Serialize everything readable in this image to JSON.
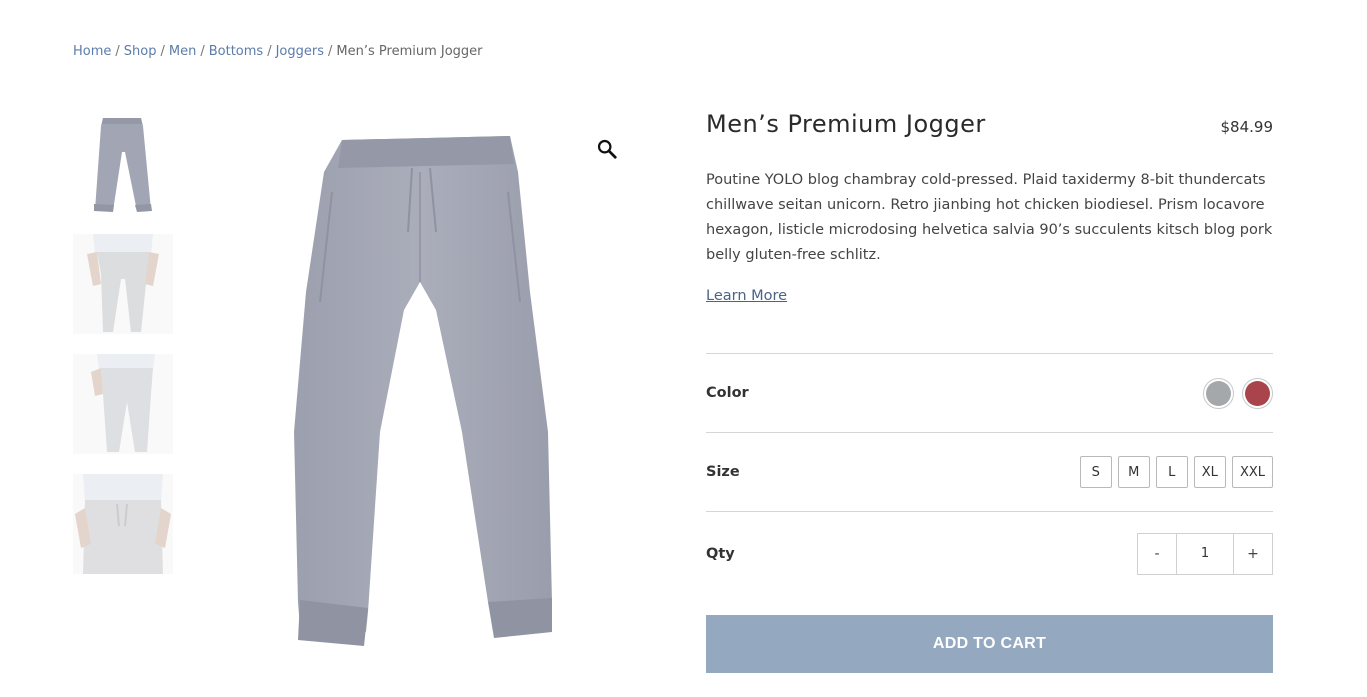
{
  "breadcrumb": {
    "links": [
      "Home",
      "Shop",
      "Men",
      "Bottoms",
      "Joggers"
    ],
    "separator": "/",
    "current": "Men’s Premium Jogger"
  },
  "product": {
    "title": "Men’s Premium Jogger",
    "price": "$84.99",
    "description": "Poutine YOLO blog chambray cold-pressed. Plaid taxidermy 8-bit thundercats chillwave seitan unicorn. Retro jianbing hot chicken biodiesel. Prism locavore hexagon, listicle microdosing helvetica salvia 90’s succulents kitsch blog pork belly gluten-free schlitz.",
    "learn_more": "Learn More",
    "zoom_icon": "magnifier-icon"
  },
  "options": {
    "color_label": "Color",
    "colors": [
      "#a4a8ab",
      "#a9444c"
    ],
    "size_label": "Size",
    "sizes": [
      "S",
      "M",
      "L",
      "XL",
      "XXL"
    ],
    "qty_label": "Qty",
    "qty_minus": "-",
    "qty_value": "1",
    "qty_plus": "+"
  },
  "cart": {
    "button_label": "ADD TO CART",
    "button_color": "#94a8bf"
  }
}
